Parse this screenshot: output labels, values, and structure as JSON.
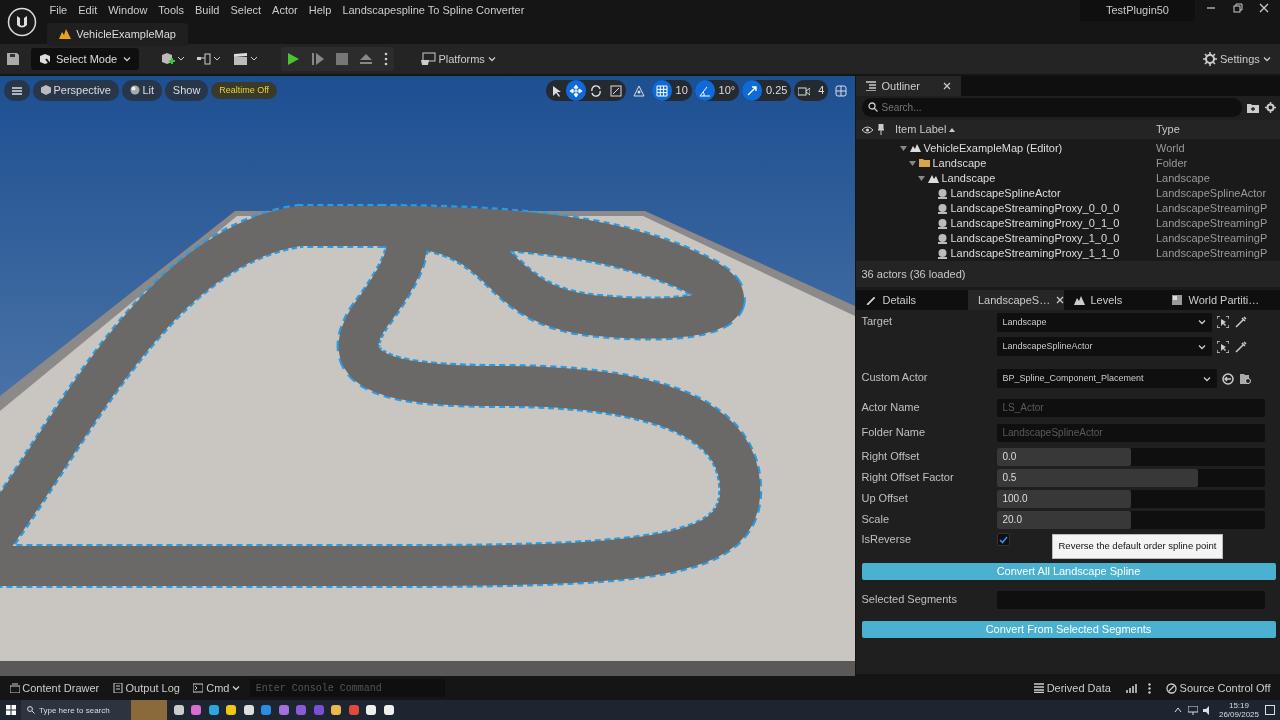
{
  "menu": [
    "File",
    "Edit",
    "Window",
    "Tools",
    "Build",
    "Select",
    "Actor",
    "Help",
    "Landscapespline To Spline Converter"
  ],
  "project_name": "TestPlugin50",
  "map_tab": "VehicleExampleMap",
  "toolbar": {
    "mode": "Select Mode",
    "platforms": "Platforms",
    "settings": "Settings"
  },
  "viewport": {
    "buttons": [
      {
        "label": "Perspective",
        "kind": "camera"
      },
      {
        "label": "Lit",
        "kind": "lit"
      },
      {
        "label": "Show",
        "kind": "plain"
      },
      {
        "label": "Realtime Off",
        "kind": "warning"
      }
    ],
    "transform_tools": [
      {
        "kind": "select",
        "selected": false
      },
      {
        "kind": "translate",
        "selected": true
      },
      {
        "kind": "rotate",
        "selected": false
      },
      {
        "kind": "scale",
        "selected": false
      }
    ],
    "snaps": [
      {
        "kind": "grid",
        "value": "10",
        "on": true
      },
      {
        "kind": "angle",
        "value": "10°",
        "on": true
      },
      {
        "kind": "scale",
        "value": "0.25",
        "on": true
      },
      {
        "kind": "camera",
        "value": "4",
        "on": false
      }
    ]
  },
  "outliner": {
    "title": "Outliner",
    "search_placeholder": "Search...",
    "columns": [
      "Item Label",
      "Type"
    ],
    "rows": [
      {
        "label": "VehicleExampleMap (Editor)",
        "type": "World",
        "kind": "world",
        "expanded": true,
        "children": [
          {
            "label": "Landscape",
            "type": "Folder",
            "kind": "folder",
            "expanded": true,
            "children": [
              {
                "label": "Landscape",
                "type": "Landscape",
                "kind": "landscape",
                "expanded": true,
                "children": [
                  {
                    "label": "LandscapeSplineActor",
                    "type": "LandscapeSplineActor",
                    "kind": "actor"
                  },
                  {
                    "label": "LandscapeStreamingProxy_0_0_0",
                    "type": "LandscapeStreamingP",
                    "kind": "actor"
                  },
                  {
                    "label": "LandscapeStreamingProxy_0_1_0",
                    "type": "LandscapeStreamingP",
                    "kind": "actor"
                  },
                  {
                    "label": "LandscapeStreamingProxy_1_0_0",
                    "type": "LandscapeStreamingP",
                    "kind": "actor"
                  },
                  {
                    "label": "LandscapeStreamingProxy_1_1_0",
                    "type": "LandscapeStreamingP",
                    "kind": "actor"
                  }
                ]
              }
            ]
          }
        ]
      }
    ],
    "status": "36 actors (36 loaded)"
  },
  "details_tabs": [
    {
      "label": "Details",
      "kind": "details",
      "selected": false
    },
    {
      "label": "LandscapeS…",
      "kind": "tool",
      "selected": true
    },
    {
      "label": "Levels",
      "kind": "levels",
      "selected": false
    },
    {
      "label": "World Partiti…",
      "kind": "partition",
      "selected": false
    }
  ],
  "properties": [
    {
      "label": "Target",
      "kind": "object_pick",
      "values": [
        "Landscape",
        "LandscapeSplineActor"
      ]
    },
    {
      "label": "Custom Actor",
      "kind": "class_pick",
      "value": "BP_Spline_Component_Placement"
    },
    {
      "label": "Actor Name",
      "kind": "text",
      "placeholder": "LS_Actor"
    },
    {
      "label": "Folder Name",
      "kind": "text",
      "placeholder": "LandscapeSplineActor"
    },
    {
      "label": "Right Offset",
      "kind": "slider",
      "value": "0.0",
      "level": 0.5
    },
    {
      "label": "Right Offset Factor",
      "kind": "slider",
      "value": "0.5",
      "level": 0.75
    },
    {
      "label": "Up Offset",
      "kind": "slider",
      "value": "100.0",
      "level": 0.5
    },
    {
      "label": "Scale",
      "kind": "slider",
      "value": "20.0",
      "level": 0.5
    },
    {
      "label": "IsReverse",
      "kind": "checkbox",
      "checked": true,
      "tooltip": "Reverse the default order spline point"
    },
    {
      "label": "Convert All Landscape Spline",
      "kind": "button"
    },
    {
      "label": "Selected Segments",
      "kind": "text"
    },
    {
      "label": "Convert From Selected Segments",
      "kind": "button"
    }
  ],
  "status_bar": {
    "left": [
      "Content Drawer",
      "Output Log",
      "Cmd"
    ],
    "console_placeholder": "Enter Console Command",
    "right": [
      "Derived Data",
      "Source Control Off"
    ]
  },
  "taskbar": {
    "search_placeholder": "Type here to search",
    "time": "15:19",
    "date": "26/09/2025"
  }
}
